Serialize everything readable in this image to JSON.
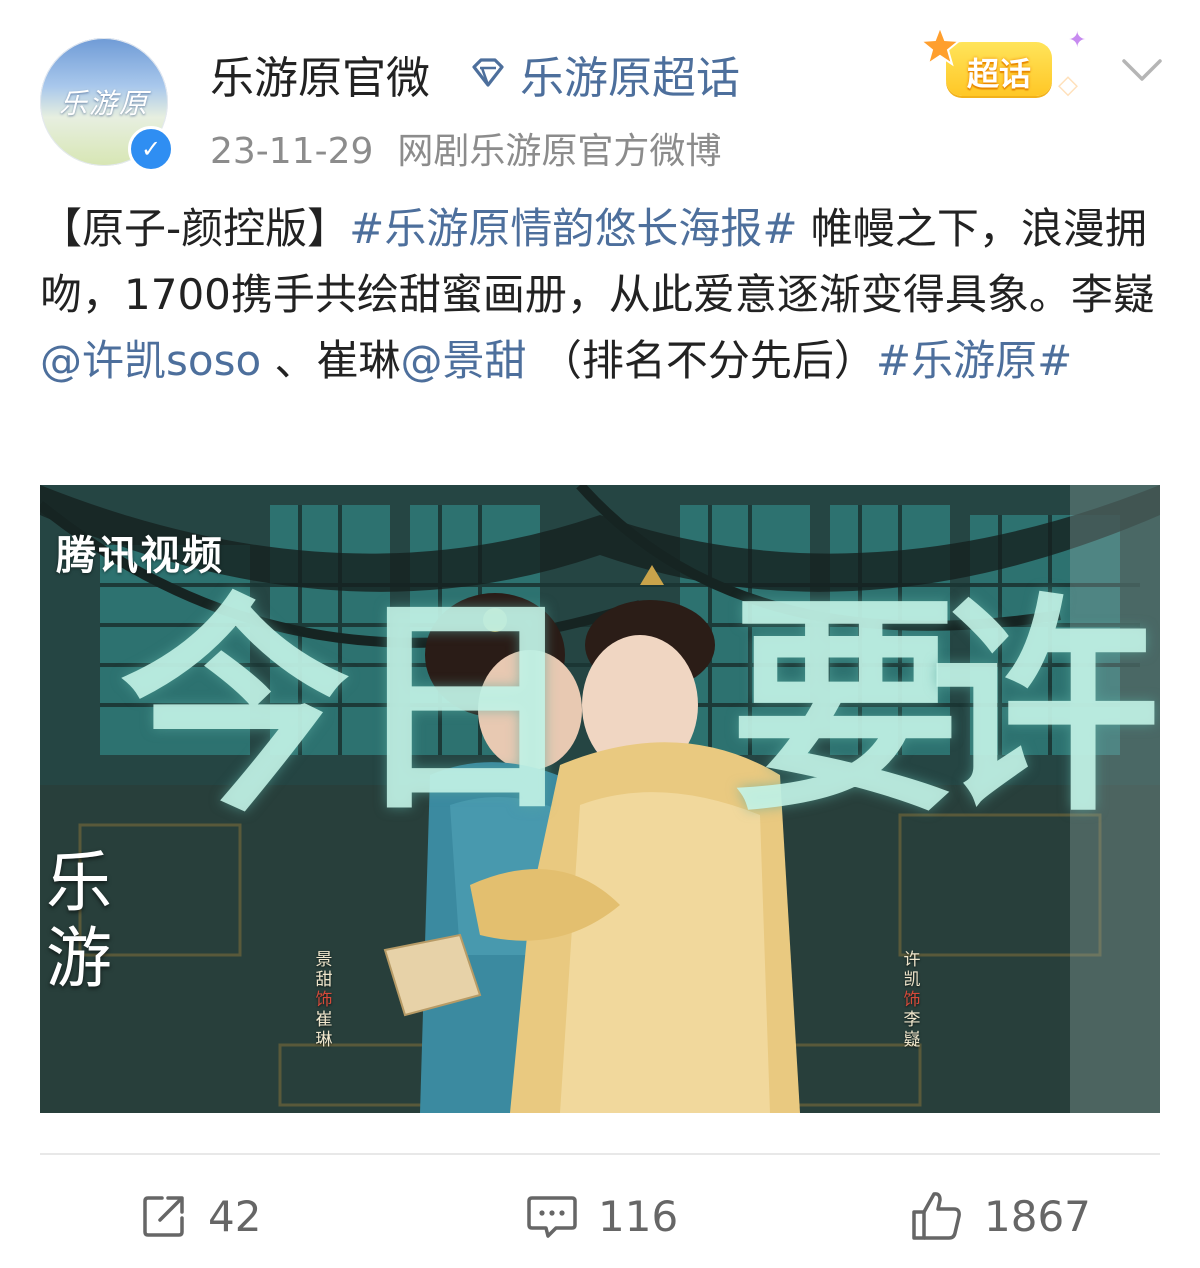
{
  "account": {
    "avatar_text": "乐游原",
    "name": "乐游原官微",
    "topic_link": "乐游原超话",
    "date": "23-11-29",
    "source": "网剧乐游原官方微博",
    "verified_mark": "✓"
  },
  "super_topic_badge": {
    "label": "超话",
    "icon": "star-icon"
  },
  "post": {
    "prefix": "【原子-颜控版】",
    "hashtag1": "#乐游原情韵悠长海报#",
    "body1": " 帷幔之下，浪漫拥吻，1700携手共绘甜蜜画册，从此爱意逐渐变得具象。李嶷",
    "mention1": "@许凯soso",
    "body2": " 、崔琳",
    "mention2": "@景甜",
    "body3": " （排名不分先后）",
    "hashtag2": "#乐游原#"
  },
  "poster": {
    "brand": "腾讯视频",
    "title_chars": [
      "今",
      "日",
      "要",
      "许"
    ],
    "side_title": [
      "乐",
      "游"
    ],
    "credit_left": [
      "景",
      "甜",
      "饰",
      "崔",
      "琳"
    ],
    "credit_right": [
      "许",
      "凯",
      "饰",
      "李",
      "嶷"
    ]
  },
  "actions": {
    "repost_count": "42",
    "comment_count": "116",
    "like_count": "1867"
  },
  "colors": {
    "link": "#4d6f9c",
    "badge": "#ffc726",
    "verified": "#2f8ef2"
  }
}
